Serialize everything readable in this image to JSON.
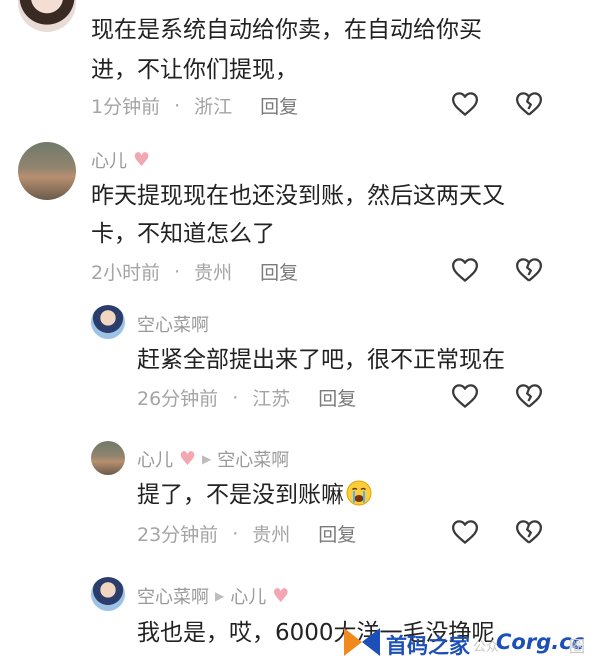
{
  "comments": [
    {
      "text_lines": [
        "现在是系统自动给你卖，在自动给你买",
        "进，不让你们提现，"
      ],
      "time": "1分钟前",
      "location": "浙江",
      "reply_label": "回复"
    },
    {
      "user": "心儿",
      "text_lines": [
        "昨天提现现在也还没到账，然后这两天又",
        "卡，不知道怎么了"
      ],
      "time": "2小时前",
      "location": "贵州",
      "reply_label": "回复"
    },
    {
      "user": "空心菜啊",
      "text_lines": [
        "赶紧全部提出来了吧，很不正常现在"
      ],
      "time": "26分钟前",
      "location": "江苏",
      "reply_label": "回复"
    },
    {
      "user": "心儿",
      "reply_to": "空心菜啊",
      "text_lines": [
        "提了，不是没到账嘛"
      ],
      "time": "23分钟前",
      "location": "贵州",
      "reply_label": "回复"
    },
    {
      "user": "空心菜啊",
      "reply_to": "心儿",
      "text_lines": [
        "我也是，哎，6000大洋一毛没挣呢"
      ]
    }
  ],
  "icons": {
    "like": "heart-outline-icon",
    "dislike": "broken-heart-icon",
    "user_badge": "pink-heart-icon",
    "reply_arrow": "triangle-right-icon",
    "crying_emoji": "crying-face-icon"
  },
  "watermark": {
    "brand": "首码之家",
    "domain": "Corg.cc",
    "tld": "圈",
    "extra": "公众"
  },
  "colors": {
    "text": "#222222",
    "meta": "#a4a4a4",
    "reply": "#7a7a7a",
    "name": "#9a9a9a",
    "badge_heart": "#f3a7b2",
    "watermark_blue": "#1d4fb8",
    "watermark_orange": "#f08a1c"
  }
}
